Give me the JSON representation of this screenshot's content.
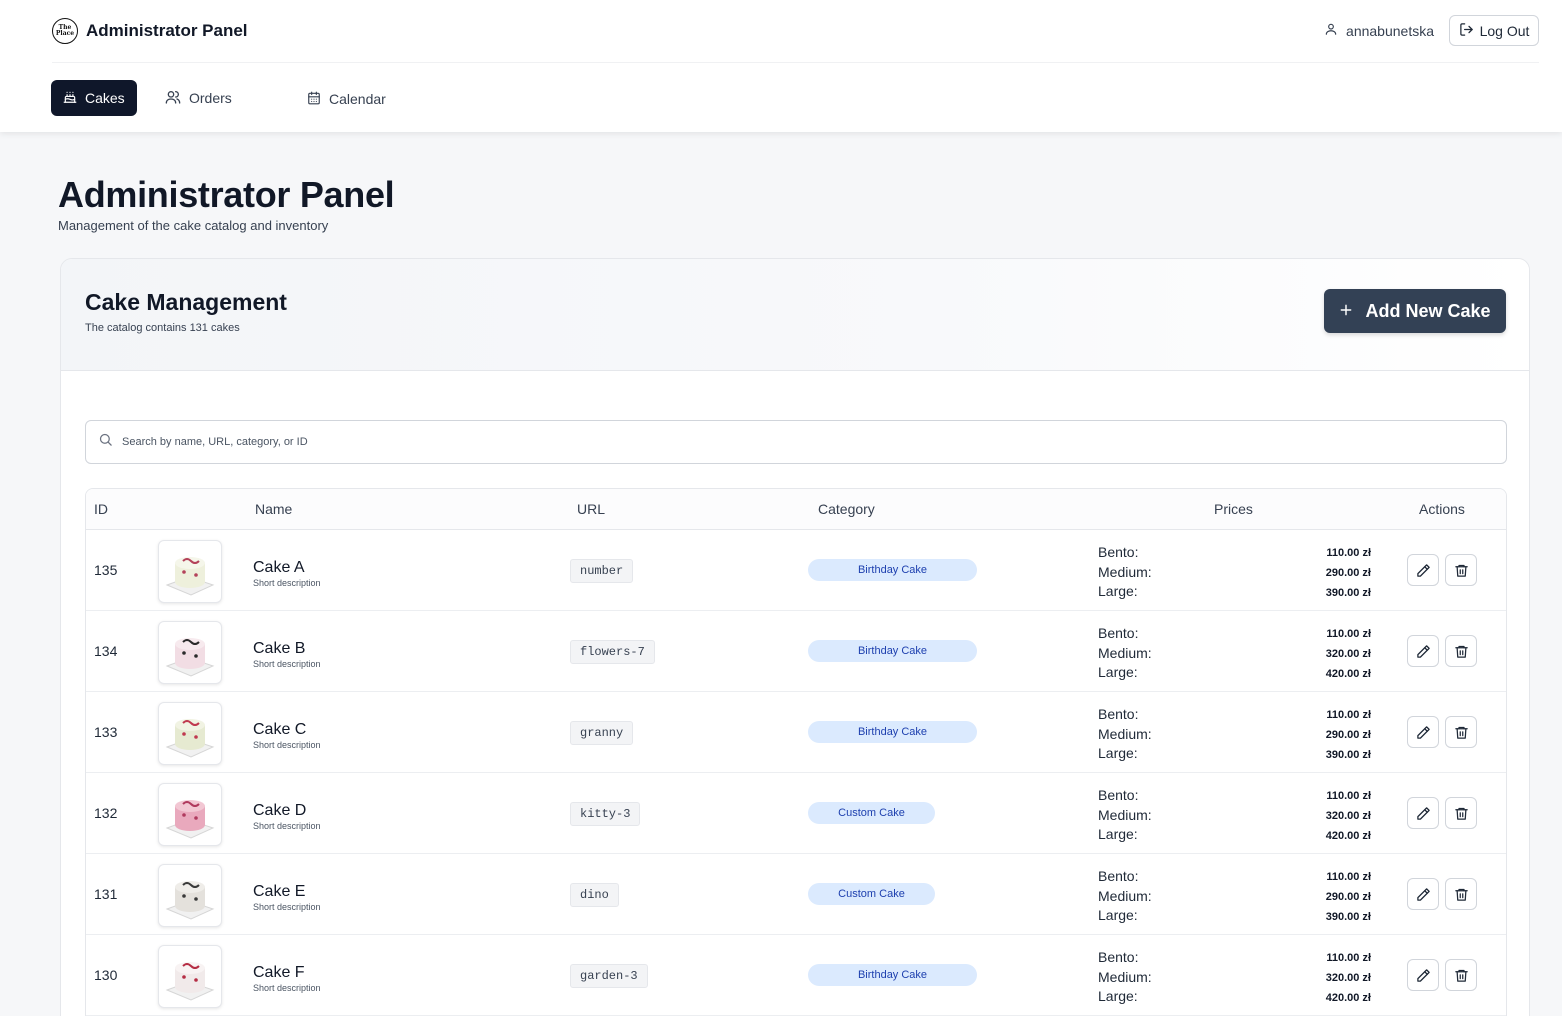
{
  "header": {
    "logo_text": "The Place",
    "title": "Administrator Panel",
    "username": "annabunetska",
    "logout_label": "Log Out"
  },
  "nav": {
    "tabs": [
      {
        "label": "Cakes",
        "icon": "cake-icon",
        "active": true
      },
      {
        "label": "Orders",
        "icon": "users-icon",
        "active": false
      },
      {
        "label": "Calendar",
        "icon": "calendar-icon",
        "active": false
      }
    ]
  },
  "page": {
    "title": "Administrator Panel",
    "subtitle": "Management of the cake catalog and inventory"
  },
  "card": {
    "title": "Cake Management",
    "subtitle": "The catalog contains 131 cakes",
    "add_button_label": "Add New Cake"
  },
  "search": {
    "placeholder": "Search by name, URL, category, or ID",
    "value": ""
  },
  "table": {
    "columns": [
      "ID",
      "Name",
      "URL",
      "Category",
      "Prices",
      "Actions"
    ],
    "price_labels": [
      "Bento:",
      "Medium:",
      "Large:"
    ],
    "rows": [
      {
        "id": "135",
        "name": "Cake A",
        "description": "Short description",
        "url": "number",
        "category": "Birthday Cake",
        "prices": [
          "110.00 zł",
          "290.00 zł",
          "390.00 zł"
        ]
      },
      {
        "id": "134",
        "name": "Cake B",
        "description": "Short description",
        "url": "flowers-7",
        "category": "Birthday Cake",
        "prices": [
          "110.00 zł",
          "320.00 zł",
          "420.00 zł"
        ]
      },
      {
        "id": "133",
        "name": "Cake C",
        "description": "Short description",
        "url": "granny",
        "category": "Birthday Cake",
        "prices": [
          "110.00 zł",
          "290.00 zł",
          "390.00 zł"
        ]
      },
      {
        "id": "132",
        "name": "Cake D",
        "description": "Short description",
        "url": "kitty-3",
        "category": "Custom Cake",
        "prices": [
          "110.00 zł",
          "320.00 zł",
          "420.00 zł"
        ]
      },
      {
        "id": "131",
        "name": "Cake E",
        "description": "Short description",
        "url": "dino",
        "category": "Custom Cake",
        "prices": [
          "110.00 zł",
          "290.00 zł",
          "390.00 zł"
        ]
      },
      {
        "id": "130",
        "name": "Cake F",
        "description": "Short description",
        "url": "garden-3",
        "category": "Birthday Cake",
        "prices": [
          "110.00 zł",
          "320.00 zł",
          "420.00 zł"
        ]
      }
    ]
  },
  "colors": {
    "nav_active": "#0f172a",
    "primary_button": "#334155",
    "badge_bg": "#dbeafe",
    "badge_text": "#1e40af"
  }
}
